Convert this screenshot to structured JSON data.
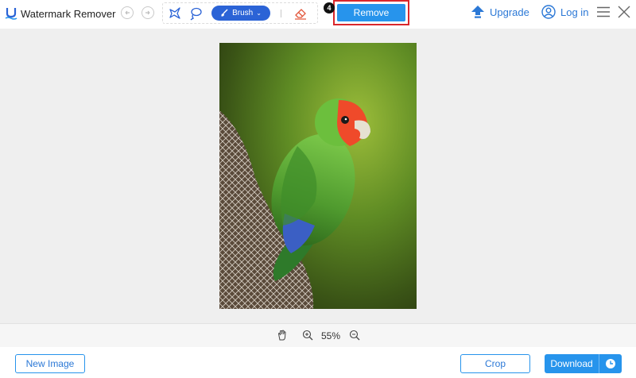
{
  "header": {
    "app_title": "Watermark Remover",
    "brush_label": "Brush",
    "step_number": "4",
    "remove_label": "Remove",
    "upgrade_label": "Upgrade",
    "login_label": "Log in"
  },
  "icons": {
    "logo": "watermark-remover-logo-icon",
    "undo": "undo-icon",
    "redo": "redo-icon",
    "polygon": "polygonal-lasso-icon",
    "lasso": "lasso-icon",
    "brush": "brush-icon",
    "eraser": "eraser-icon",
    "upgrade": "upload-arrow-icon",
    "login": "user-icon",
    "menu": "hamburger-menu-icon",
    "close": "close-icon",
    "hand": "hand-icon",
    "zoom_in": "zoom-in-icon",
    "zoom_out": "zoom-out-icon",
    "download_history": "clock-icon"
  },
  "zoom": {
    "value": "55%"
  },
  "footer": {
    "new_image_label": "New Image",
    "crop_label": "Crop",
    "download_label": "Download"
  },
  "colors": {
    "accent": "#2794ec",
    "brush_button": "#2b63d6",
    "highlight_border": "#d9262b",
    "canvas_bg": "#efefef"
  }
}
